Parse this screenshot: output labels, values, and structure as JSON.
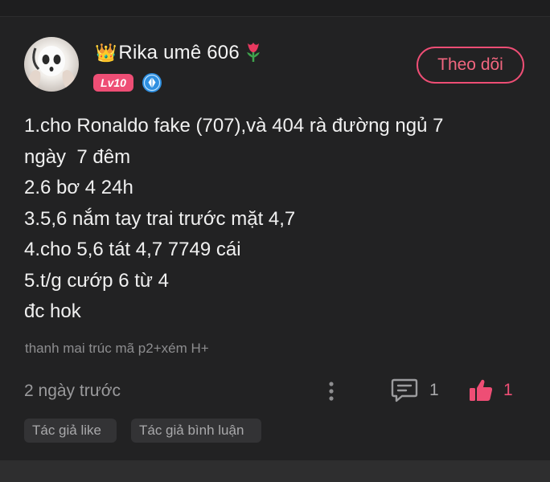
{
  "post": {
    "author": {
      "crown_glyph": "👑",
      "name": "Rika umê 606",
      "flower_icon": "tulip-icon",
      "level": "Lv10",
      "badge_icon": "diamond-badge-icon",
      "avatar": "ghost-mask-avatar"
    },
    "follow_label": "Theo dõi",
    "content_lines": [
      "1.cho Ronaldo fake (707),và 404 rà đường ngủ 7",
      "ngày  7 đêm",
      "2.6 bơ 4 24h",
      "3.5,6 nắm tay trai trước mặt 4,7",
      "4.cho 5,6 tát 4,7 7749 cái",
      "5.t/g cướp 6 từ 4",
      "đc hok"
    ],
    "signature": "thanh mai trúc mã p2+xém H+",
    "timestamp": "2 ngày trước",
    "comment_count": "1",
    "like_count": "1",
    "tags": [
      "Tác giả like",
      "Tác giả bình luận"
    ]
  },
  "colors": {
    "background": "#1e1e1f",
    "accent": "#ee4e75",
    "text_primary": "#f0f0f0",
    "text_muted": "#9a9a9c",
    "tag_bg": "#333335"
  },
  "icons": {
    "more": "vertical-dots-icon",
    "comment": "comment-icon",
    "like": "thumbs-up-icon"
  }
}
